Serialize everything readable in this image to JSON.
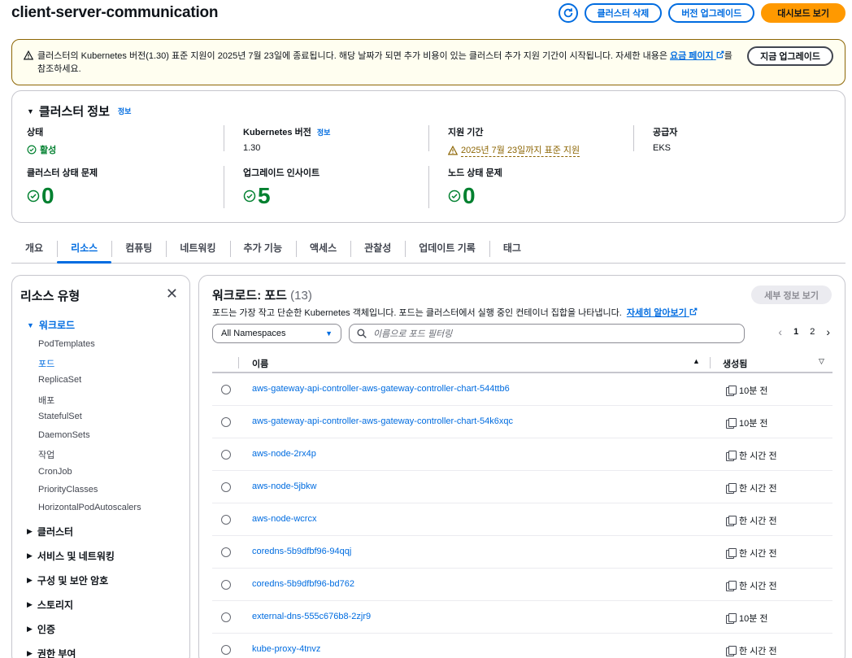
{
  "header": {
    "title": "client-server-communication",
    "delete_label": "클러스터 삭제",
    "upgrade_label": "버전 업그레이드",
    "dashboard_label": "대시보드 보기"
  },
  "alert": {
    "text_before": "클러스터의 Kubernetes 버전(1.30) 표준 지원이 2025년 7월 23일에 종료됩니다. 해당 날짜가 되면 추가 비용이 있는 클러스터 추가 지원 기간이 시작됩니다. 자세한 내용은 ",
    "link": "요금 페이지",
    "text_after": "를 참조하세요.",
    "button": "지금 업그레이드"
  },
  "cluster_info": {
    "title": "클러스터 정보",
    "info": "정보",
    "status_label": "상태",
    "status_value": "활성",
    "k8s_label": "Kubernetes 버전",
    "k8s_info": "정보",
    "k8s_value": "1.30",
    "support_label": "지원 기간",
    "support_value": "2025년 7월 23일까지 표준 지원",
    "provider_label": "공급자",
    "provider_value": "EKS",
    "health_label": "클러스터 상태 문제",
    "health_value": "0",
    "insights_label": "업그레이드 인사이트",
    "insights_value": "5",
    "node_label": "노드 상태 문제",
    "node_value": "0"
  },
  "tabs": [
    "개요",
    "리소스",
    "컴퓨팅",
    "네트워킹",
    "추가 기능",
    "액세스",
    "관찰성",
    "업데이트 기록",
    "태그"
  ],
  "sidebar": {
    "title": "리소스 유형",
    "workload_group": "워크로드",
    "workload_items": [
      "PodTemplates",
      "포드",
      "ReplicaSet",
      "배포",
      "StatefulSet",
      "DaemonSets",
      "작업",
      "CronJob",
      "PriorityClasses",
      "HorizontalPodAutoscalers"
    ],
    "groups": [
      "클러스터",
      "서비스 및 네트워킹",
      "구성 및 보안 암호",
      "스토리지",
      "인증",
      "권한 부여"
    ]
  },
  "main": {
    "title": "워크로드: 포드",
    "count": "(13)",
    "detail_button": "세부 정보 보기",
    "description": "포드는 가장 작고 단순한 Kubernetes 객체입니다. 포드는 클러스터에서 실행 중인 컨테이너 집합을 나타냅니다.",
    "learn_more": "자세히 알아보기",
    "namespace": "All Namespaces",
    "search_placeholder": "이름으로 포드 필터링",
    "page_1": "1",
    "page_2": "2",
    "col_name": "이름",
    "col_created": "생성됨",
    "rows": [
      {
        "name": "aws-gateway-api-controller-aws-gateway-controller-chart-544ttb6",
        "age": "10분 전"
      },
      {
        "name": "aws-gateway-api-controller-aws-gateway-controller-chart-54k6xqc",
        "age": "10분 전"
      },
      {
        "name": "aws-node-2rx4p",
        "age": "한 시간 전"
      },
      {
        "name": "aws-node-5jbkw",
        "age": "한 시간 전"
      },
      {
        "name": "aws-node-wcrcx",
        "age": "한 시간 전"
      },
      {
        "name": "coredns-5b9dfbf96-94qqj",
        "age": "한 시간 전"
      },
      {
        "name": "coredns-5b9dfbf96-bd762",
        "age": "한 시간 전"
      },
      {
        "name": "external-dns-555c676b8-2zjr9",
        "age": "10분 전"
      },
      {
        "name": "kube-proxy-4tnvz",
        "age": "한 시간 전"
      }
    ]
  }
}
